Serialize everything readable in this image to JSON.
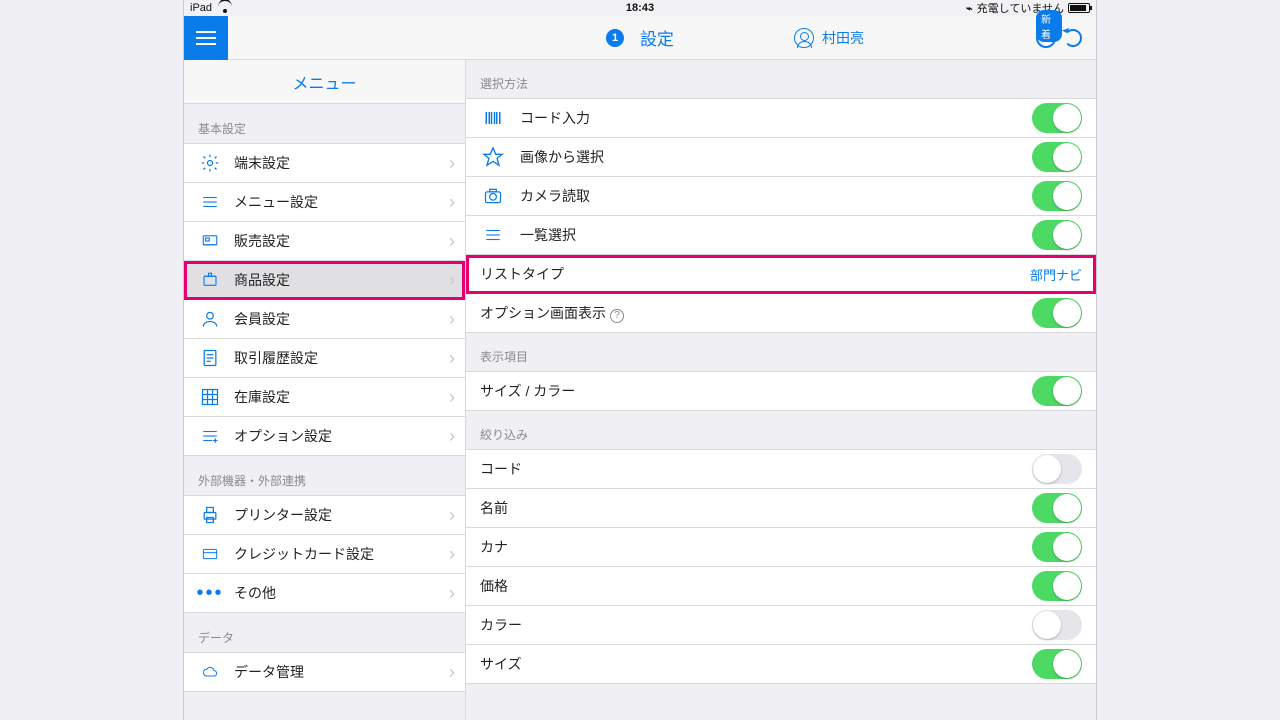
{
  "status": {
    "device": "iPad",
    "time": "18:43",
    "charge": "充電していません"
  },
  "appbar": {
    "badge": "1",
    "title": "設定",
    "user": "村田亮",
    "new_badge": "新着"
  },
  "sidebar": {
    "title": "メニュー",
    "groups": [
      {
        "header": "基本設定",
        "items": [
          {
            "icon": "gear",
            "label": "端末設定"
          },
          {
            "icon": "lines",
            "label": "メニュー設定"
          },
          {
            "icon": "register",
            "label": "販売設定"
          },
          {
            "icon": "product",
            "label": "商品設定",
            "selected": true,
            "hot": true
          },
          {
            "icon": "user",
            "label": "会員設定"
          },
          {
            "icon": "doc",
            "label": "取引履歴設定"
          },
          {
            "icon": "grid",
            "label": "在庫設定"
          },
          {
            "icon": "linesplus",
            "label": "オプション設定"
          }
        ]
      },
      {
        "header": "外部機器・外部連携",
        "items": [
          {
            "icon": "printer",
            "label": "プリンター設定"
          },
          {
            "icon": "card",
            "label": "クレジットカード設定"
          },
          {
            "icon": "dots",
            "label": "その他"
          }
        ]
      },
      {
        "header": "データ",
        "items": [
          {
            "icon": "cloud",
            "label": "データ管理"
          }
        ]
      }
    ]
  },
  "detail": {
    "sections": [
      {
        "header": "選択方法",
        "rows": [
          {
            "icon": "barcode",
            "label": "コード入力",
            "toggle": true
          },
          {
            "icon": "star",
            "label": "画像から選択",
            "toggle": true
          },
          {
            "icon": "camera",
            "label": "カメラ読取",
            "toggle": true
          },
          {
            "icon": "list",
            "label": "一覧選択",
            "toggle": true
          }
        ]
      },
      {
        "rows": [
          {
            "label": "リストタイプ",
            "link": "部門ナビ",
            "hot": true
          },
          {
            "label": "オプション画面表示",
            "help": true,
            "toggle": true
          }
        ]
      },
      {
        "header": "表示項目",
        "rows": [
          {
            "label": "サイズ / カラー",
            "toggle": true
          }
        ]
      },
      {
        "header": "絞り込み",
        "rows": [
          {
            "label": "コード",
            "toggle": false
          },
          {
            "label": "名前",
            "toggle": true
          },
          {
            "label": "カナ",
            "toggle": true
          },
          {
            "label": "価格",
            "toggle": true
          },
          {
            "label": "カラー",
            "toggle": false
          },
          {
            "label": "サイズ",
            "toggle": true
          }
        ]
      }
    ]
  }
}
